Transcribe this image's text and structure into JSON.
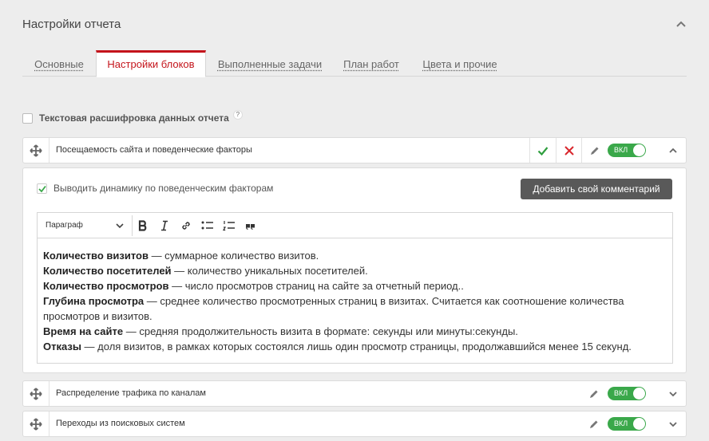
{
  "header": {
    "title": "Настройки отчета"
  },
  "tabs": [
    {
      "label": "Основные",
      "active": false
    },
    {
      "label": "Настройки блоков",
      "active": true
    },
    {
      "label": "Выполненные задачи",
      "active": false
    },
    {
      "label": "План работ",
      "active": false
    },
    {
      "label": "Цвета и прочие",
      "active": false
    }
  ],
  "text_decode": {
    "label": "Текстовая расшифровка данных отчета",
    "checked": false,
    "help": "?"
  },
  "blocks": [
    {
      "name": "Посещаемость сайта и поведенческие факторы",
      "toggle": "ВКЛ",
      "expanded": true
    },
    {
      "name": "Распределение трафика по каналам",
      "toggle": "ВКЛ",
      "expanded": false
    },
    {
      "name": "Переходы из поисковых систем",
      "toggle": "ВКЛ",
      "expanded": false
    }
  ],
  "panel": {
    "dynamics_label": "Выводить динамику по поведенческим факторам",
    "dynamics_checked": true,
    "add_comment_label": "Добавить свой комментарий"
  },
  "editor": {
    "format_select": "Параграф",
    "toolbar_icons": [
      "bold-icon",
      "italic-icon",
      "link-icon",
      "bulleted-list-icon",
      "numbered-list-icon",
      "quote-icon"
    ],
    "lines": [
      {
        "term": "Количество визитов",
        "desc": " — суммарное количество визитов."
      },
      {
        "term": "Количество посетителей",
        "desc": " — количество уникальных посетителей."
      },
      {
        "term": "Количество просмотров",
        "desc": " — число просмотров страниц на сайте за отчетный период.."
      },
      {
        "term": "Глубина просмотра",
        "desc": " — среднее количество просмотренных страниц в визитах. Считается как соотношение количества просмотров и визитов."
      },
      {
        "term": "Время на сайте",
        "desc": " — средняя продолжительность визита в формате: секунды или минуты:секунды."
      },
      {
        "term": "Отказы",
        "desc": " — доля визитов, в рамках которых состоялся лишь один просмотр страницы, продолжавшийся менее 15 секунд."
      }
    ]
  },
  "colors": {
    "accent": "#c4141b",
    "toggle_on": "#3aa84a",
    "confirm": "#2e9e3e",
    "cancel": "#d9262c",
    "button_dark": "#595959"
  }
}
